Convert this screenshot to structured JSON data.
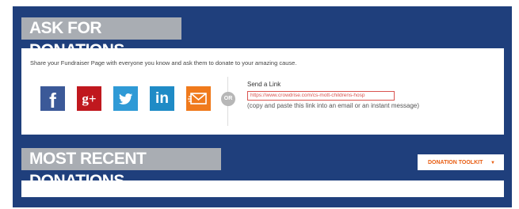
{
  "headings": {
    "ask": "ASK FOR DONATIONS",
    "recent": "MOST RECENT DONATIONS"
  },
  "share": {
    "intro": "Share your Fundraiser Page with everyone you know and ask them to donate to your amazing cause.",
    "icons": [
      {
        "name": "facebook-icon",
        "label": "f"
      },
      {
        "name": "google-plus-icon",
        "label": "g+"
      },
      {
        "name": "twitter-icon",
        "label": ""
      },
      {
        "name": "linkedin-icon",
        "label": "in"
      },
      {
        "name": "email-icon",
        "label": ""
      }
    ],
    "or_label": "OR",
    "send_link_label": "Send a Link",
    "link_value": "https://www.crowdrise.com/cs-mott-childrens-hosp",
    "link_hint": "(copy and paste this link into an email or an instant message)"
  },
  "toolkit": {
    "label": "DONATION TOOLKIT"
  },
  "colors": {
    "panel_bg": "#1f3f7c",
    "heading_bg": "#a9adb3",
    "accent": "#e85d12",
    "facebook": "#3b5998",
    "google_plus": "#c0181e",
    "twitter": "#2f9ad6",
    "linkedin": "#1f8bc6",
    "email": "#f07a1c"
  }
}
